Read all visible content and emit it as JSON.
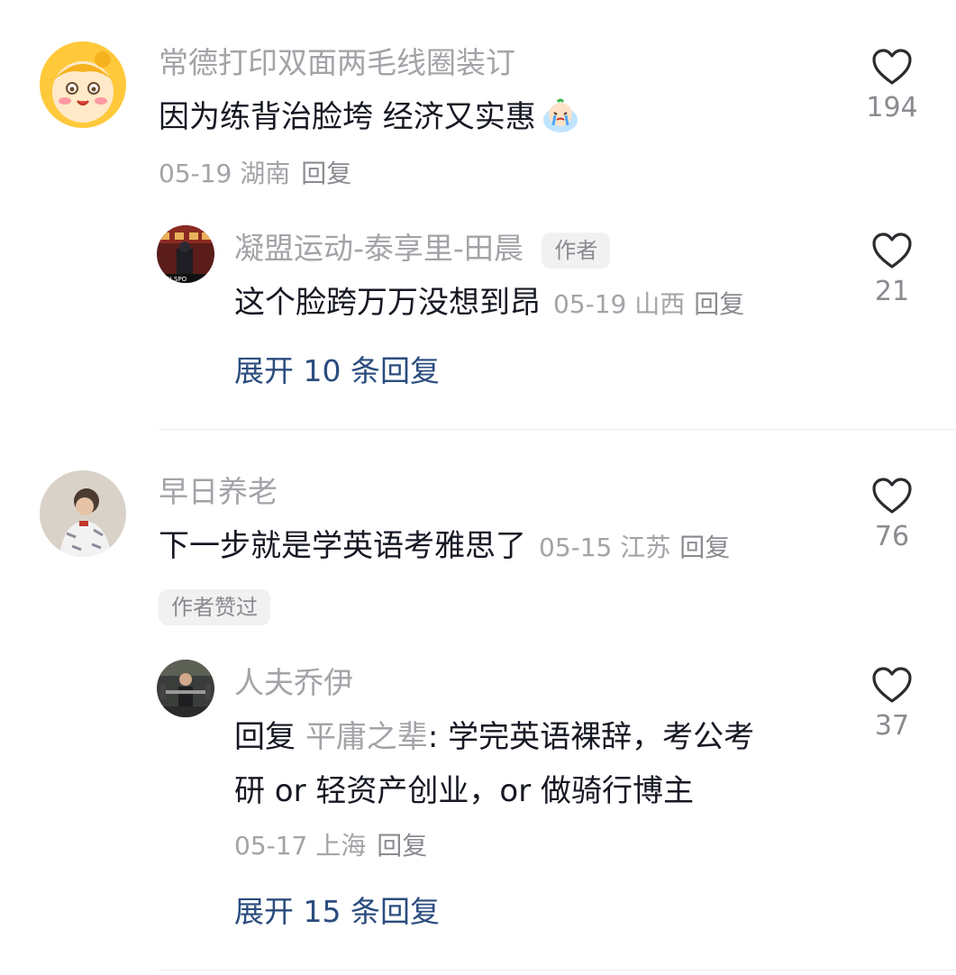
{
  "comments": [
    {
      "username": "常德打印双面两毛线圈装订",
      "text": "因为练背治脸垮 经济又实惠",
      "date": "05-19",
      "location": "湖南",
      "reply_label": "回复",
      "likes": "194",
      "emoji_icon": "crying-face-emoji",
      "replies": [
        {
          "username": "凝盟运动-泰享里-田晨",
          "badge": "作者",
          "text": "这个脸跨万万没想到昂",
          "date": "05-19",
          "location": "山西",
          "reply_label": "回复",
          "likes": "21"
        }
      ],
      "expand_label": "展开 10 条回复"
    },
    {
      "username": "早日养老",
      "text": "下一步就是学英语考雅思了",
      "date": "05-15",
      "location": "江苏",
      "reply_label": "回复",
      "likes": "76",
      "author_liked_badge": "作者赞过",
      "replies": [
        {
          "username": "人夫乔伊",
          "reply_prefix": "回复",
          "reply_to": "平庸之辈",
          "text_line1": ": 学完英语裸辞，考公考",
          "text_line2": "研 or 轻资产创业，or 做骑行博主",
          "date": "05-17",
          "location": "上海",
          "reply_label": "回复",
          "likes": "37"
        }
      ],
      "expand_label": "展开 15 条回复"
    }
  ],
  "colors": {
    "primary_text": "#161823",
    "secondary_text": "#a3a3a8",
    "link": "#2b4c7e",
    "badge_bg": "#f1f1f2"
  }
}
